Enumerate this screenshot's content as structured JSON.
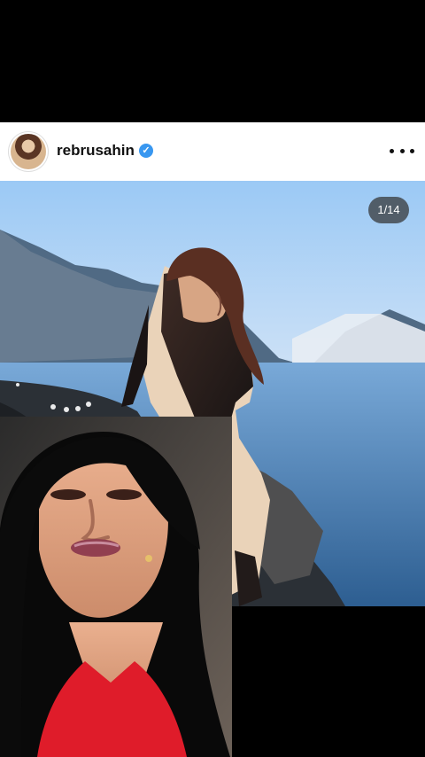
{
  "post": {
    "username": "rebrusahin",
    "verified": true,
    "more_icon": "more-horizontal-icon",
    "image_counter": "1/14"
  },
  "colors": {
    "verified_blue": "#3897f0",
    "header_background": "#ffffff",
    "screen_background": "#000000"
  }
}
